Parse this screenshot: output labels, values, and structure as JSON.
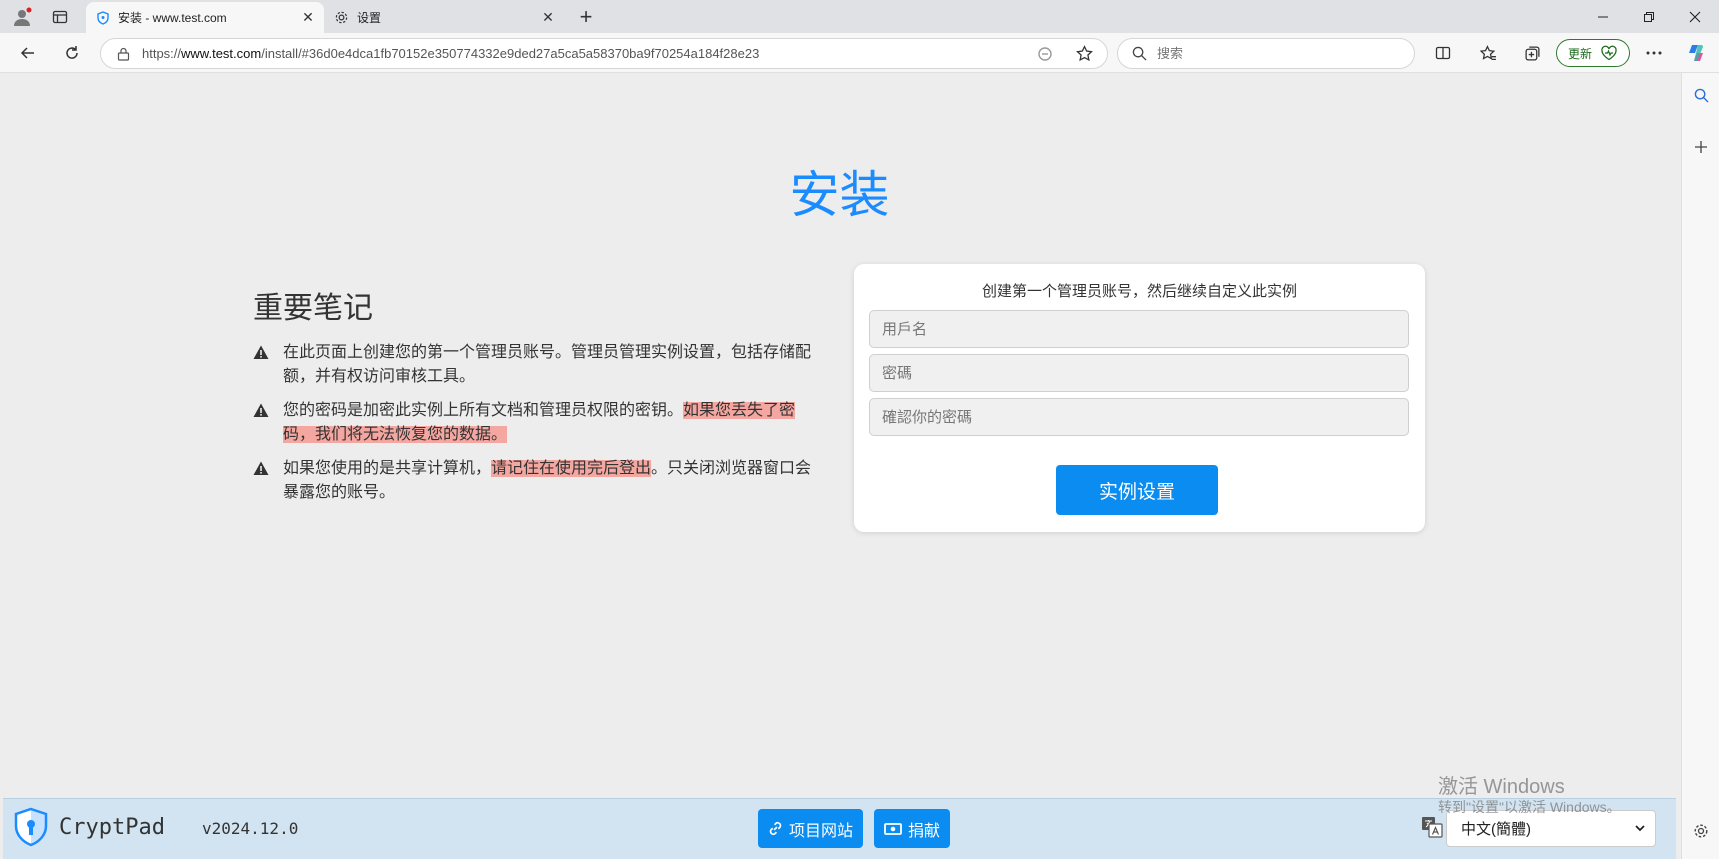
{
  "browser": {
    "tabs": [
      {
        "label": "安装 - www.test.com",
        "active": true
      },
      {
        "label": "设置",
        "active": false
      }
    ],
    "url_prefix": "https://",
    "url_host": "www.test.com",
    "url_path": "/install/#36d0e4dca1fb70152e350774332e9ded27a5ca5a58370ba9f70254a184f28e23",
    "search_placeholder": "搜索",
    "update_label": "更新",
    "close_glyph": "✕",
    "new_tab_glyph": "+"
  },
  "page": {
    "title": "安装",
    "notes": {
      "heading": "重要笔记",
      "items": [
        {
          "text": "在此页面上创建您的第一个管理员账号。管理员管理实例设置，包括存储配额，并有权访问审核工具。",
          "highlight": ""
        },
        {
          "text": "您的密码是加密此实例上所有文档和管理员权限的密钥。",
          "highlight": "如果您丢失了密码，我们将无法恢复您的数据。",
          "after": ""
        },
        {
          "text": "如果您使用的是共享计算机，",
          "highlight": "请记住在使用完后登出",
          "after": "。只关闭浏览器窗口会暴露您的账号。"
        }
      ]
    },
    "form": {
      "title": "创建第一个管理员账号，然后继续自定义此实例",
      "username_placeholder": "用戶名",
      "password_placeholder": "密碼",
      "confirm_placeholder": "確認你的密碼",
      "submit_label": "实例设置"
    }
  },
  "footer": {
    "brand": "CryptPad",
    "version": "v2024.12.0",
    "project_site_label": "项目网站",
    "donate_label": "捐献",
    "language": "中文(簡體)"
  },
  "watermark": {
    "line1": "激活 Windows",
    "line2": "转到\"设置\"以激活 Windows。"
  },
  "colors": {
    "accent": "#0a8cf0",
    "title": "#1a8cff",
    "highlight": "#f4a6a0",
    "footer_bg": "#d2e4f2"
  }
}
